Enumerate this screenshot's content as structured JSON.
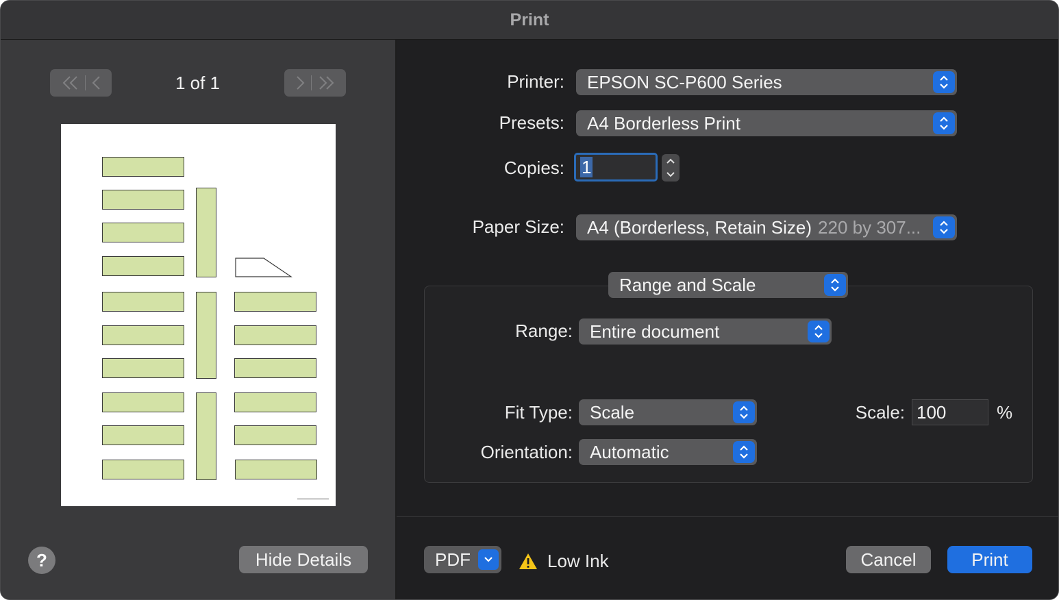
{
  "window": {
    "title": "Print"
  },
  "preview": {
    "page_counter": "1 of 1",
    "first_icon": "double-chevron-left-icon",
    "prev_icon": "chevron-left-icon",
    "next_icon": "chevron-right-icon",
    "last_icon": "double-chevron-right-icon"
  },
  "left_footer": {
    "help_label": "?",
    "hide_details_label": "Hide Details"
  },
  "form": {
    "printer": {
      "label": "Printer:",
      "value": "EPSON SC-P600 Series"
    },
    "presets": {
      "label": "Presets:",
      "value": "A4 Borderless Print"
    },
    "copies": {
      "label": "Copies:",
      "value": "1"
    },
    "paper_size": {
      "label": "Paper Size:",
      "value": "A4 (Borderless, Retain Size)",
      "detail": "220 by 307..."
    },
    "section": {
      "value": "Range and Scale"
    },
    "range": {
      "label": "Range:",
      "value": "Entire document"
    },
    "fit_type": {
      "label": "Fit Type:",
      "value": "Scale"
    },
    "scale": {
      "label": "Scale:",
      "value": "100",
      "unit": "%"
    },
    "orientation": {
      "label": "Orientation:",
      "value": "Automatic"
    }
  },
  "footer": {
    "pdf_label": "PDF",
    "warning_icon": "warning-triangle-icon",
    "warning_text": "Low Ink",
    "cancel_label": "Cancel",
    "print_label": "Print"
  },
  "colors": {
    "accent": "#1f6fe0",
    "preview_block": "#d3e2a6",
    "warning": "#f5c518"
  }
}
